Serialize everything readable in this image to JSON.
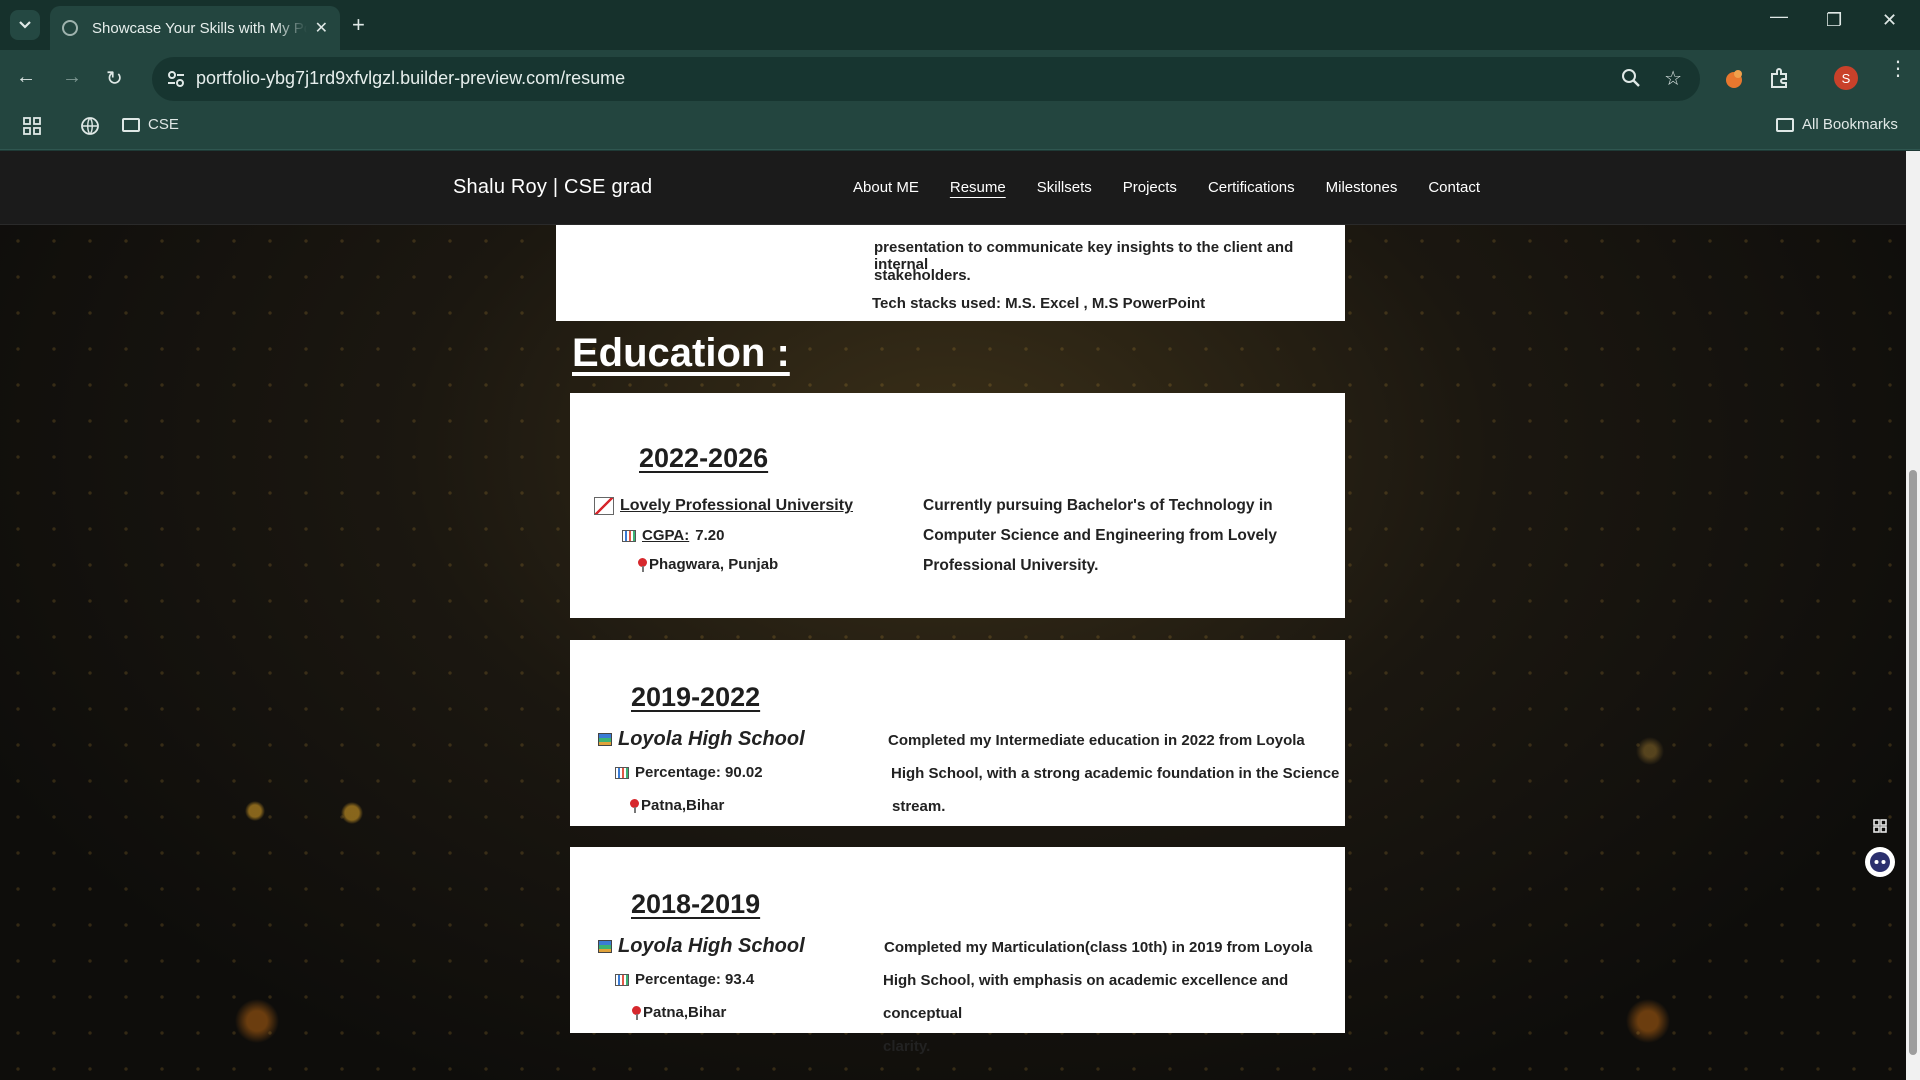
{
  "browser": {
    "tab_title": "Showcase Your Skills with My Portfolio",
    "new_tab_symbol": "+",
    "url": "portfolio-ybg7j1rd9xfvlgzl.builder-preview.com/resume",
    "avatar_letter": "S",
    "bookmarks": {
      "folder": "CSE",
      "all": "All Bookmarks"
    }
  },
  "site": {
    "brand": "Shalu Roy | CSE grad",
    "nav": [
      "About ME",
      "Resume",
      "Skillsets",
      "Projects",
      "Certifications",
      "Milestones",
      "Contact"
    ],
    "active_nav": "Resume"
  },
  "experience_tail": {
    "line1": "presentation to communicate key insights to the client and internal",
    "line2": "stakeholders.",
    "tech": "Tech stacks used: M.S. Excel , M.S PowerPoint"
  },
  "education": {
    "heading": "Education :",
    "entries": [
      {
        "years": "2022-2026",
        "institution": "Lovely Professional University",
        "score_label": "CGPA:",
        "score_value": " 7.20",
        "location": "Phagwara, Punjab",
        "desc": [
          "Currently pursuing Bachelor's of Technology in",
          "Computer Science and Engineering from Lovely",
          "Professional University."
        ]
      },
      {
        "years": "2019-2022",
        "institution": "Loyola High School",
        "score": "Percentage: 90.02",
        "location": "Patna,Bihar",
        "desc": [
          "Completed my Intermediate education in 2022 from Loyola",
          "High School, with a strong academic foundation in the Science",
          "stream."
        ]
      },
      {
        "years": "2018-2019",
        "institution": "Loyola High School",
        "score": "Percentage: 93.4",
        "location": "Patna,Bihar",
        "desc": [
          "Completed my Marticulation(class 10th) in 2019 from Loyola",
          "High School, with emphasis on academic excellence and conceptual",
          "clarity."
        ]
      }
    ]
  },
  "colors": {
    "chrome": "#23453f",
    "page_bg": "#0e0d0b",
    "accent_glow": "#e6aa28"
  }
}
